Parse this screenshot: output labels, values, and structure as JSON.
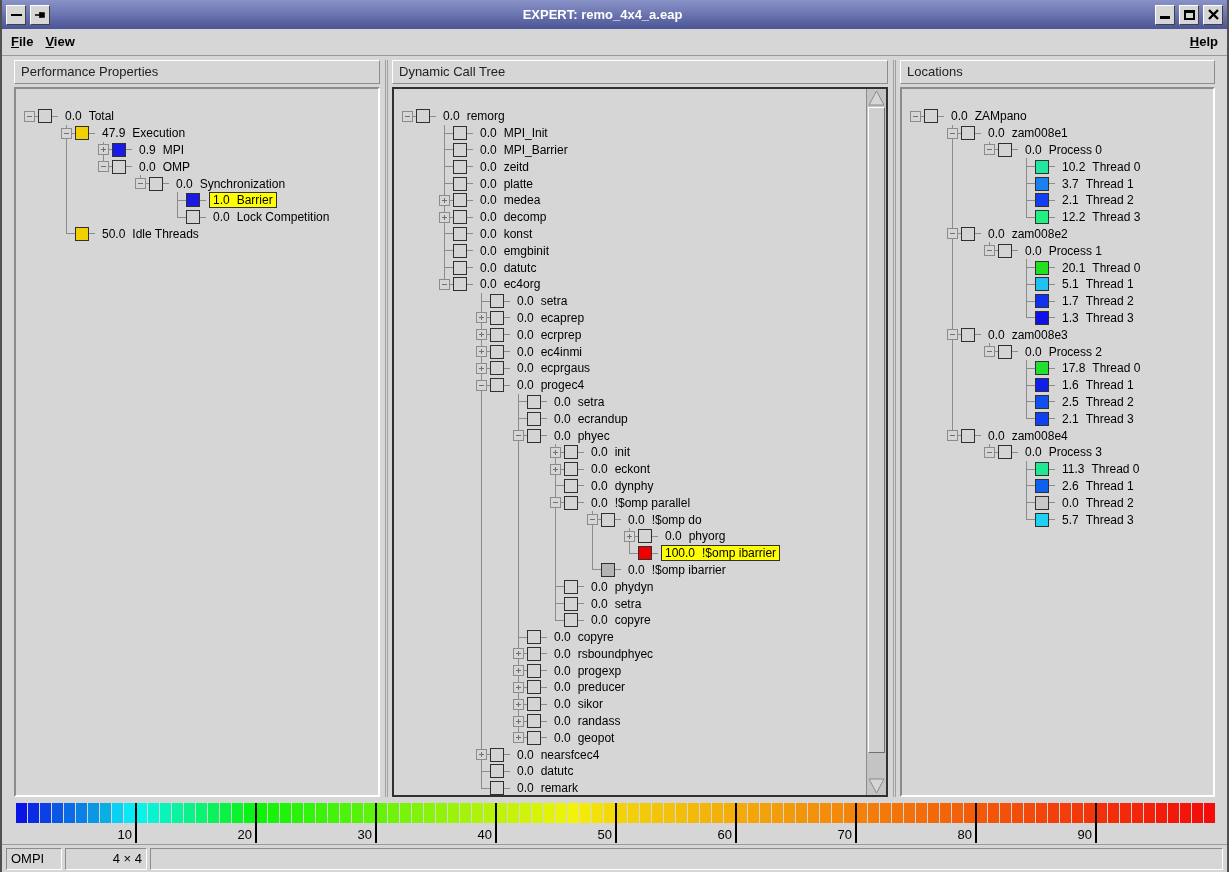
{
  "window": {
    "title": "EXPERT: remo_4x4_a.eap"
  },
  "menu": {
    "left": [
      {
        "label": "File",
        "first_letter_underlined": true
      },
      {
        "label": "View",
        "first_letter_underlined": true
      }
    ],
    "right": [
      {
        "label": "Help",
        "first_letter_underlined": true
      }
    ]
  },
  "panels": [
    {
      "title": "Performance Properties",
      "tree": [
        {
          "severity": "0.0",
          "name": "Total",
          "color": "#d4d4d4",
          "expanded": true,
          "selected": false,
          "children": [
            {
              "severity": "47.9",
              "name": "Execution",
              "color": "#f2cf00",
              "expanded": true,
              "selected": false,
              "children": [
                {
                  "severity": "0.9",
                  "name": "MPI",
                  "color": "#1a1ae6",
                  "expanded": false,
                  "selected": false
                },
                {
                  "severity": "0.0",
                  "name": "OMP",
                  "color": "#d4d4d4",
                  "expanded": true,
                  "selected": false,
                  "children": [
                    {
                      "severity": "0.0",
                      "name": "Synchronization",
                      "color": "#d4d4d4",
                      "expanded": true,
                      "selected": false,
                      "children": [
                        {
                          "severity": "1.0",
                          "name": "Barrier",
                          "color": "#1a1ae0",
                          "selected": true
                        },
                        {
                          "severity": "0.0",
                          "name": "Lock Competition",
                          "color": "#d4d4d4",
                          "selected": false
                        }
                      ]
                    }
                  ]
                }
              ]
            },
            {
              "severity": "50.0",
              "name": "Idle Threads",
              "color": "#f2cf00",
              "selected": false
            }
          ]
        }
      ]
    },
    {
      "title": "Dynamic Call Tree",
      "tree": [
        {
          "severity": "0.0",
          "name": "remorg",
          "color": "#d4d4d4",
          "expanded": true,
          "selected": false,
          "children": [
            {
              "severity": "0.0",
              "name": "MPI_Init",
              "color": "#d4d4d4",
              "selected": false
            },
            {
              "severity": "0.0",
              "name": "MPI_Barrier",
              "color": "#d4d4d4",
              "selected": false
            },
            {
              "severity": "0.0",
              "name": "zeitd",
              "color": "#d4d4d4",
              "selected": false
            },
            {
              "severity": "0.0",
              "name": "platte",
              "color": "#d4d4d4",
              "selected": false
            },
            {
              "severity": "0.0",
              "name": "medea",
              "color": "#d4d4d4",
              "expanded": false,
              "selected": false
            },
            {
              "severity": "0.0",
              "name": "decomp",
              "color": "#d4d4d4",
              "expanded": false,
              "selected": false
            },
            {
              "severity": "0.0",
              "name": "konst",
              "color": "#d4d4d4",
              "selected": false
            },
            {
              "severity": "0.0",
              "name": "emgbinit",
              "color": "#d4d4d4",
              "selected": false
            },
            {
              "severity": "0.0",
              "name": "datutc",
              "color": "#d4d4d4",
              "selected": false
            },
            {
              "severity": "0.0",
              "name": "ec4org",
              "color": "#d4d4d4",
              "expanded": true,
              "selected": false,
              "children": [
                {
                  "severity": "0.0",
                  "name": "setra",
                  "color": "#d4d4d4",
                  "selected": false
                },
                {
                  "severity": "0.0",
                  "name": "ecaprep",
                  "color": "#d4d4d4",
                  "expanded": false,
                  "selected": false
                },
                {
                  "severity": "0.0",
                  "name": "ecrprep",
                  "color": "#d4d4d4",
                  "expanded": false,
                  "selected": false
                },
                {
                  "severity": "0.0",
                  "name": "ec4inmi",
                  "color": "#d4d4d4",
                  "expanded": false,
                  "selected": false
                },
                {
                  "severity": "0.0",
                  "name": "ecprgaus",
                  "color": "#d4d4d4",
                  "expanded": false,
                  "selected": false
                },
                {
                  "severity": "0.0",
                  "name": "progec4",
                  "color": "#d4d4d4",
                  "expanded": true,
                  "selected": false,
                  "children": [
                    {
                      "severity": "0.0",
                      "name": "setra",
                      "color": "#d4d4d4",
                      "selected": false
                    },
                    {
                      "severity": "0.0",
                      "name": "ecrandup",
                      "color": "#d4d4d4",
                      "selected": false
                    },
                    {
                      "severity": "0.0",
                      "name": "phyec",
                      "color": "#d4d4d4",
                      "expanded": true,
                      "selected": false,
                      "children": [
                        {
                          "severity": "0.0",
                          "name": "init",
                          "color": "#d4d4d4",
                          "expanded": false,
                          "selected": false
                        },
                        {
                          "severity": "0.0",
                          "name": "eckont",
                          "color": "#d4d4d4",
                          "expanded": false,
                          "selected": false
                        },
                        {
                          "severity": "0.0",
                          "name": "dynphy",
                          "color": "#d4d4d4",
                          "selected": false
                        },
                        {
                          "severity": "0.0",
                          "name": "!$omp parallel",
                          "color": "#d4d4d4",
                          "expanded": true,
                          "selected": false,
                          "children": [
                            {
                              "severity": "0.0",
                              "name": "!$omp do",
                              "color": "#d4d4d4",
                              "expanded": true,
                              "selected": false,
                              "children": [
                                {
                                  "severity": "0.0",
                                  "name": "phyorg",
                                  "color": "#d4d4d4",
                                  "expanded": false,
                                  "selected": false
                                },
                                {
                                  "severity": "100.0",
                                  "name": "!$omp ibarrier",
                                  "color": "#ee0000",
                                  "selected": true
                                }
                              ]
                            },
                            {
                              "severity": "0.0",
                              "name": "!$omp ibarrier",
                              "color": "#b4b4b4",
                              "selected": false
                            }
                          ]
                        },
                        {
                          "severity": "0.0",
                          "name": "phydyn",
                          "color": "#d4d4d4",
                          "selected": false
                        },
                        {
                          "severity": "0.0",
                          "name": "setra",
                          "color": "#d4d4d4",
                          "selected": false
                        },
                        {
                          "severity": "0.0",
                          "name": "copyre",
                          "color": "#d4d4d4",
                          "selected": false
                        }
                      ]
                    },
                    {
                      "severity": "0.0",
                      "name": "copyre",
                      "color": "#d4d4d4",
                      "selected": false
                    },
                    {
                      "severity": "0.0",
                      "name": "rsboundphyec",
                      "color": "#d4d4d4",
                      "expanded": false,
                      "selected": false
                    },
                    {
                      "severity": "0.0",
                      "name": "progexp",
                      "color": "#d4d4d4",
                      "expanded": false,
                      "selected": false
                    },
                    {
                      "severity": "0.0",
                      "name": "preducer",
                      "color": "#d4d4d4",
                      "expanded": false,
                      "selected": false
                    },
                    {
                      "severity": "0.0",
                      "name": "sikor",
                      "color": "#d4d4d4",
                      "expanded": false,
                      "selected": false
                    },
                    {
                      "severity": "0.0",
                      "name": "randass",
                      "color": "#d4d4d4",
                      "expanded": false,
                      "selected": false
                    },
                    {
                      "severity": "0.0",
                      "name": "geopot",
                      "color": "#d4d4d4",
                      "expanded": false,
                      "selected": false
                    }
                  ]
                },
                {
                  "severity": "0.0",
                  "name": "nearsfcec4",
                  "color": "#d4d4d4",
                  "expanded": false,
                  "selected": false
                },
                {
                  "severity": "0.0",
                  "name": "datutc",
                  "color": "#d4d4d4",
                  "selected": false
                },
                {
                  "severity": "0.0",
                  "name": "remark",
                  "color": "#d4d4d4",
                  "selected": false
                }
              ]
            }
          ]
        }
      ]
    },
    {
      "title": "Locations",
      "tree": [
        {
          "severity": "0.0",
          "name": "ZAMpano",
          "color": "#d4d4d4",
          "expanded": true,
          "selected": false,
          "children": [
            {
              "severity": "0.0",
              "name": "zam008e1",
              "color": "#d4d4d4",
              "expanded": true,
              "selected": false,
              "children": [
                {
                  "severity": "0.0",
                  "name": "Process 0",
                  "color": "#d4d4d4",
                  "expanded": true,
                  "selected": false,
                  "children": [
                    {
                      "severity": "10.2",
                      "name": "Thread 0",
                      "color": "#20e8a0",
                      "selected": false
                    },
                    {
                      "severity": "3.7",
                      "name": "Thread 1",
                      "color": "#1a80f0",
                      "selected": false
                    },
                    {
                      "severity": "2.1",
                      "name": "Thread 2",
                      "color": "#1040f0",
                      "selected": false
                    },
                    {
                      "severity": "12.2",
                      "name": "Thread 3",
                      "color": "#20f080",
                      "selected": false
                    }
                  ]
                }
              ]
            },
            {
              "severity": "0.0",
              "name": "zam008e2",
              "color": "#d4d4d4",
              "expanded": true,
              "selected": false,
              "children": [
                {
                  "severity": "0.0",
                  "name": "Process 1",
                  "color": "#d4d4d4",
                  "expanded": true,
                  "selected": false,
                  "children": [
                    {
                      "severity": "20.1",
                      "name": "Thread 0",
                      "color": "#20e020",
                      "selected": false
                    },
                    {
                      "severity": "5.1",
                      "name": "Thread 1",
                      "color": "#20c0f0",
                      "selected": false
                    },
                    {
                      "severity": "1.7",
                      "name": "Thread 2",
                      "color": "#1030f0",
                      "selected": false
                    },
                    {
                      "severity": "1.3",
                      "name": "Thread 3",
                      "color": "#1010e8",
                      "selected": false
                    }
                  ]
                }
              ]
            },
            {
              "severity": "0.0",
              "name": "zam008e3",
              "color": "#d4d4d4",
              "expanded": true,
              "selected": false,
              "children": [
                {
                  "severity": "0.0",
                  "name": "Process 2",
                  "color": "#d4d4d4",
                  "expanded": true,
                  "selected": false,
                  "children": [
                    {
                      "severity": "17.8",
                      "name": "Thread 0",
                      "color": "#20e030",
                      "selected": false
                    },
                    {
                      "severity": "1.6",
                      "name": "Thread 1",
                      "color": "#1020e8",
                      "selected": false
                    },
                    {
                      "severity": "2.5",
                      "name": "Thread 2",
                      "color": "#1050f0",
                      "selected": false
                    },
                    {
                      "severity": "2.1",
                      "name": "Thread 3",
                      "color": "#1040f0",
                      "selected": false
                    }
                  ]
                }
              ]
            },
            {
              "severity": "0.0",
              "name": "zam008e4",
              "color": "#d4d4d4",
              "expanded": true,
              "selected": false,
              "children": [
                {
                  "severity": "0.0",
                  "name": "Process 3",
                  "color": "#d4d4d4",
                  "expanded": true,
                  "selected": false,
                  "children": [
                    {
                      "severity": "11.3",
                      "name": "Thread 0",
                      "color": "#20e890",
                      "selected": false
                    },
                    {
                      "severity": "2.6",
                      "name": "Thread 1",
                      "color": "#1060f0",
                      "selected": false
                    },
                    {
                      "severity": "0.0",
                      "name": "Thread 2",
                      "color": "#c8c8c8",
                      "selected": false
                    },
                    {
                      "severity": "5.7",
                      "name": "Thread 3",
                      "color": "#20d0f0",
                      "selected": false
                    }
                  ]
                }
              ]
            }
          ]
        }
      ]
    }
  ],
  "color_scale": {
    "ticks": [
      "10",
      "20",
      "30",
      "40",
      "50",
      "60",
      "70",
      "80",
      "90"
    ]
  },
  "status_bar": [
    "OMPI",
    "4 × 4"
  ]
}
